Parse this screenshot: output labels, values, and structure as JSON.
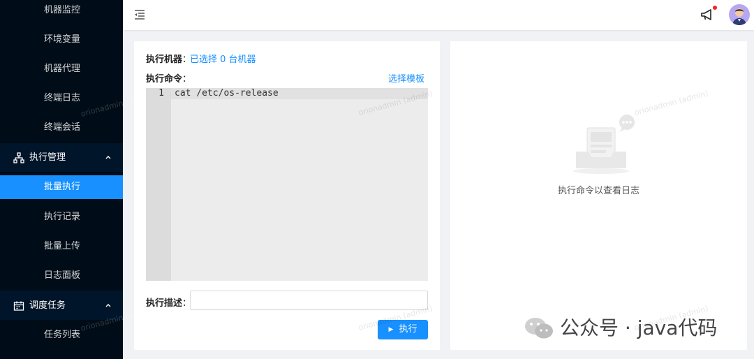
{
  "sidebar": {
    "items_top": [
      {
        "label": "机器监控"
      },
      {
        "label": "环境变量"
      },
      {
        "label": "机器代理"
      },
      {
        "label": "终端日志"
      },
      {
        "label": "终端会话"
      }
    ],
    "group_exec": {
      "label": "执行管理",
      "icon": "sitemap-icon"
    },
    "exec_items": [
      {
        "label": "批量执行",
        "active": true
      },
      {
        "label": "执行记录"
      },
      {
        "label": "批量上传"
      },
      {
        "label": "日志面板"
      }
    ],
    "group_sched": {
      "label": "调度任务",
      "icon": "calendar-icon"
    },
    "sched_items": [
      {
        "label": "任务列表"
      }
    ]
  },
  "header": {
    "collapse_icon": "menu-fold-icon",
    "notify_icon": "megaphone-icon",
    "avatar_icon": "user-avatar"
  },
  "exec_panel": {
    "machine_label": "执行机器",
    "machine_value": "已选择 0 台机器",
    "command_label": "执行命令",
    "template_link": "选择模板",
    "line_number": "1",
    "command_code": "cat /etc/os-release",
    "desc_label": "执行描述",
    "desc_value": "",
    "execute_button": "执行"
  },
  "log_panel": {
    "empty_text": "执行命令以查看日志"
  },
  "watermark_text": "orionadmin (admin)",
  "overlay": {
    "wechat_text": "公众号 · java代码"
  },
  "colors": {
    "primary": "#1890ff",
    "sidebar_bg": "#001529",
    "sidebar_sub_bg": "#000c17"
  }
}
